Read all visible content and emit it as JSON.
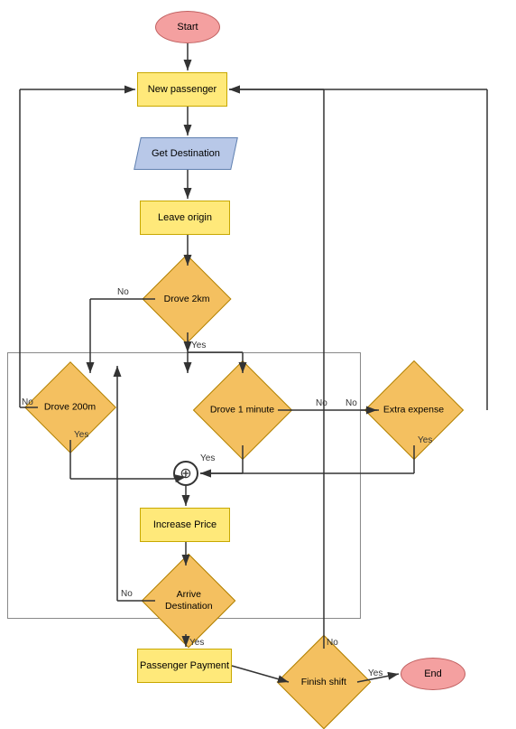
{
  "nodes": {
    "start": {
      "label": "Start"
    },
    "new_passenger": {
      "label": "New passenger"
    },
    "get_destination": {
      "label": "Get Destination"
    },
    "leave_origin": {
      "label": "Leave origin"
    },
    "drove_2km": {
      "label": "Drove 2km"
    },
    "drove_200m": {
      "label": "Drove 200m"
    },
    "drove_1min": {
      "label": "Drove 1 minute"
    },
    "extra_expense": {
      "label": "Extra expense"
    },
    "increase_price": {
      "label": "Increase Price"
    },
    "arrive_dest": {
      "label": "Arrive Destination"
    },
    "passenger_payment": {
      "label": "Passenger Payment"
    },
    "finish_shift": {
      "label": "Finish shift"
    },
    "end": {
      "label": "End"
    }
  },
  "labels": {
    "no": "No",
    "yes": "Yes"
  }
}
